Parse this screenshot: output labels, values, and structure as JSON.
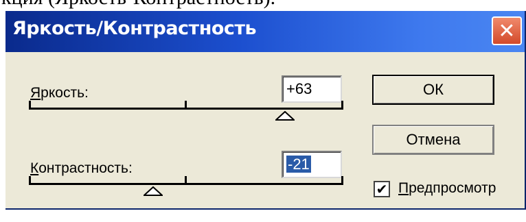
{
  "caption": "кция (Яркость-Контрастность).",
  "window": {
    "title": "Яркость/Контрастность",
    "close_glyph": "✕"
  },
  "brightness": {
    "label_first": "Я",
    "label_rest": "ркость:",
    "value": "+63",
    "slider_value": 63,
    "slider_min": -100,
    "slider_max": 100
  },
  "contrast": {
    "label_first": "К",
    "label_rest": "онтрастность:",
    "value": "-21",
    "slider_value": -21,
    "slider_min": -100,
    "slider_max": 100
  },
  "buttons": {
    "ok_label": "ОК",
    "cancel_label": "Отмена"
  },
  "preview": {
    "checked": true,
    "check_glyph": "✔",
    "label_first": "П",
    "label_rest": "редпросмотр"
  },
  "colors": {
    "title_bar": "#1c4fcf",
    "dialog_bg": "#ece9d8",
    "close_button": "#d34a2a",
    "selection": "#2a5ba8"
  }
}
